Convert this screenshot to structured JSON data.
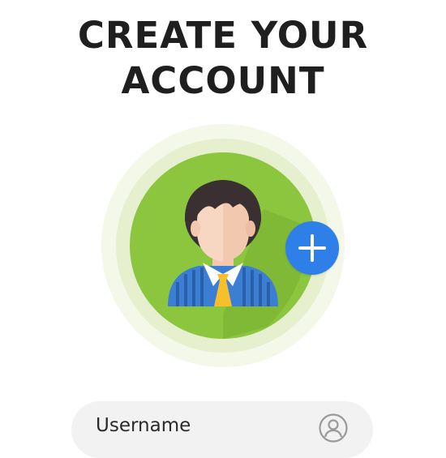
{
  "header": {
    "title_line1": "CREATE YOUR",
    "title_line2": "ACCOUNT"
  },
  "avatar": {
    "icon": "user-avatar-icon",
    "add_icon": "plus-icon"
  },
  "form": {
    "username_placeholder": "Username",
    "username_icon": "user-circle-icon"
  },
  "colors": {
    "title": "#1f1f1f",
    "ring_outer": "#f1f6e6",
    "ring_middle": "#e2eec8",
    "circle": "#8cc63f",
    "add_button": "#2f7fe9",
    "field_background": "#f2f2f2"
  }
}
